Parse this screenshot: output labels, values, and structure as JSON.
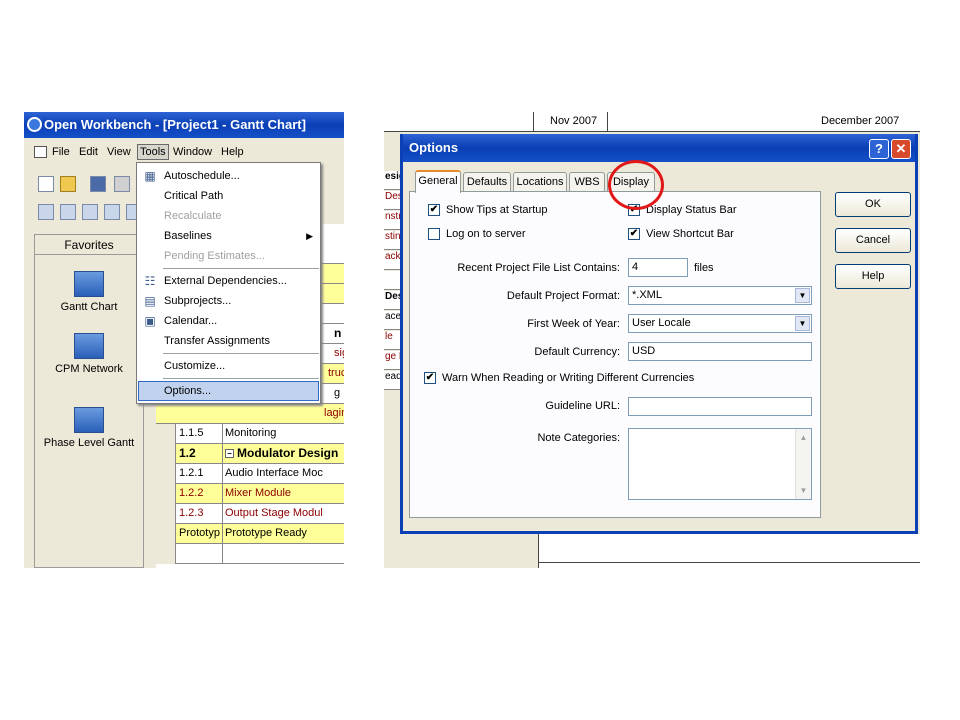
{
  "left_window": {
    "title": "Open Workbench - [Project1 - Gantt Chart]",
    "menubar": [
      "File",
      "Edit",
      "View",
      "Tools",
      "Window",
      "Help"
    ],
    "favorites": {
      "header": "Favorites",
      "items": [
        "Gantt Chart",
        "CPM Network",
        "Phase Level Gantt"
      ]
    },
    "tools_menu": {
      "items": [
        {
          "label": "Autoschedule...",
          "icon": "autoschedule-icon"
        },
        {
          "label": "Critical Path"
        },
        {
          "label": "Recalculate",
          "disabled": true
        },
        {
          "label": "Baselines",
          "submenu": true
        },
        {
          "label": "Pending Estimates...",
          "disabled": true
        },
        {
          "label": "External Dependencies...",
          "icon": "dependencies-icon"
        },
        {
          "label": "Subprojects...",
          "icon": "subprojects-icon"
        },
        {
          "label": "Calendar...",
          "icon": "calendar-icon"
        },
        {
          "label": "Transfer Assignments"
        },
        {
          "label": "Customize..."
        },
        {
          "label": "Options...",
          "highlighted": true
        }
      ]
    },
    "grid_partial": {
      "peek_rows": [
        "n",
        "sign",
        "tructio",
        "g",
        "laging"
      ],
      "rows": [
        {
          "id": "1.1.5",
          "name": "Monitoring"
        },
        {
          "id": "1.2",
          "name": "Modulator Design",
          "bold": true
        },
        {
          "id": "1.2.1",
          "name": "Audio Interface Moc"
        },
        {
          "id": "1.2.2",
          "name": "Mixer Module",
          "red": true
        },
        {
          "id": "1.2.3",
          "name": "Output Stage Modul",
          "red": true
        },
        {
          "id": "Prototyp",
          "name": "Prototype Ready"
        },
        {
          "id": "",
          "name": ""
        }
      ]
    }
  },
  "right_window": {
    "timeline": {
      "month1": "Nov 2007",
      "month2": "December 2007"
    },
    "bg_rows": [
      "esig",
      "Des",
      "nstr",
      "stin",
      "acka",
      "",
      "Des",
      "ace",
      "le",
      "ge M",
      "ead"
    ],
    "dialog": {
      "title": "Options",
      "help_button": "?",
      "close_button": "✕",
      "tabs": [
        "General",
        "Defaults",
        "Locations",
        "WBS",
        "Display"
      ],
      "active_tab": "General",
      "checkboxes": {
        "show_tips": {
          "label": "Show Tips at Startup",
          "checked": true
        },
        "display_status_bar": {
          "label": "Display Status Bar",
          "checked": true
        },
        "log_on_server": {
          "label": "Log on to server",
          "checked": false
        },
        "view_shortcut_bar": {
          "label": "View Shortcut Bar",
          "checked": true
        },
        "warn_currencies": {
          "label": "Warn When Reading or Writing Different Currencies",
          "checked": true
        }
      },
      "fields": {
        "recent_label": "Recent Project File List Contains:",
        "recent_value": "4",
        "recent_unit": "files",
        "format_label": "Default Project Format:",
        "format_value": "*.XML",
        "week_label": "First Week of Year:",
        "week_value": "User Locale",
        "currency_label": "Default Currency:",
        "currency_value": "USD",
        "guideline_label": "Guideline URL:",
        "guideline_value": "",
        "notes_label": "Note Categories:"
      },
      "buttons": {
        "ok": "OK",
        "cancel": "Cancel",
        "help": "Help"
      }
    }
  }
}
